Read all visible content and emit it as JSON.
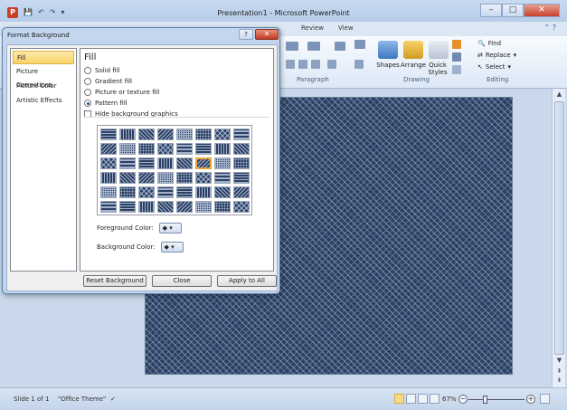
{
  "window": {
    "title": "Presentation1 - Microsoft PowerPoint",
    "app_badge": "P",
    "minimize": "–",
    "maximize": "□",
    "close": "✕"
  },
  "ribbon": {
    "visible_tabs": [
      "Review",
      "View"
    ],
    "groups": {
      "paragraph": "Paragraph",
      "drawing": "Drawing",
      "editing": "Editing"
    },
    "drawing_buttons": [
      "Shapes",
      "Arrange",
      "Quick Styles"
    ],
    "editing_buttons": [
      "Find",
      "Replace",
      "Select"
    ]
  },
  "dialog": {
    "title": "Format Background",
    "help": "?",
    "close": "✕",
    "nav_items": [
      "Fill",
      "Picture Corrections",
      "Picture Color",
      "Artistic Effects"
    ],
    "selected_nav": "Fill",
    "heading": "Fill",
    "options": [
      {
        "label": "Solid fill",
        "checked": false
      },
      {
        "label": "Gradient fill",
        "checked": false
      },
      {
        "label": "Picture or texture fill",
        "checked": false
      },
      {
        "label": "Pattern fill",
        "checked": true
      }
    ],
    "hide_background": {
      "label": "Hide background graphics",
      "checked": false
    },
    "pattern_grid": {
      "rows": 6,
      "cols": 8,
      "selected_row": 2,
      "selected_col": 5
    },
    "foreground_label": "Foreground Color:",
    "background_label": "Background Color:",
    "buttons": {
      "reset": "Reset Background",
      "close": "Close",
      "apply_all": "Apply to All"
    }
  },
  "status": {
    "slide": "Slide 1 of 1",
    "theme": "\"Office Theme\"",
    "zoom": "67%",
    "zoom_out": "−",
    "zoom_in": "+"
  },
  "colors": {
    "slide_pattern_bg": "#2b4063",
    "slide_pattern_fg": "#afbed7",
    "selection": "#f8d26a"
  }
}
